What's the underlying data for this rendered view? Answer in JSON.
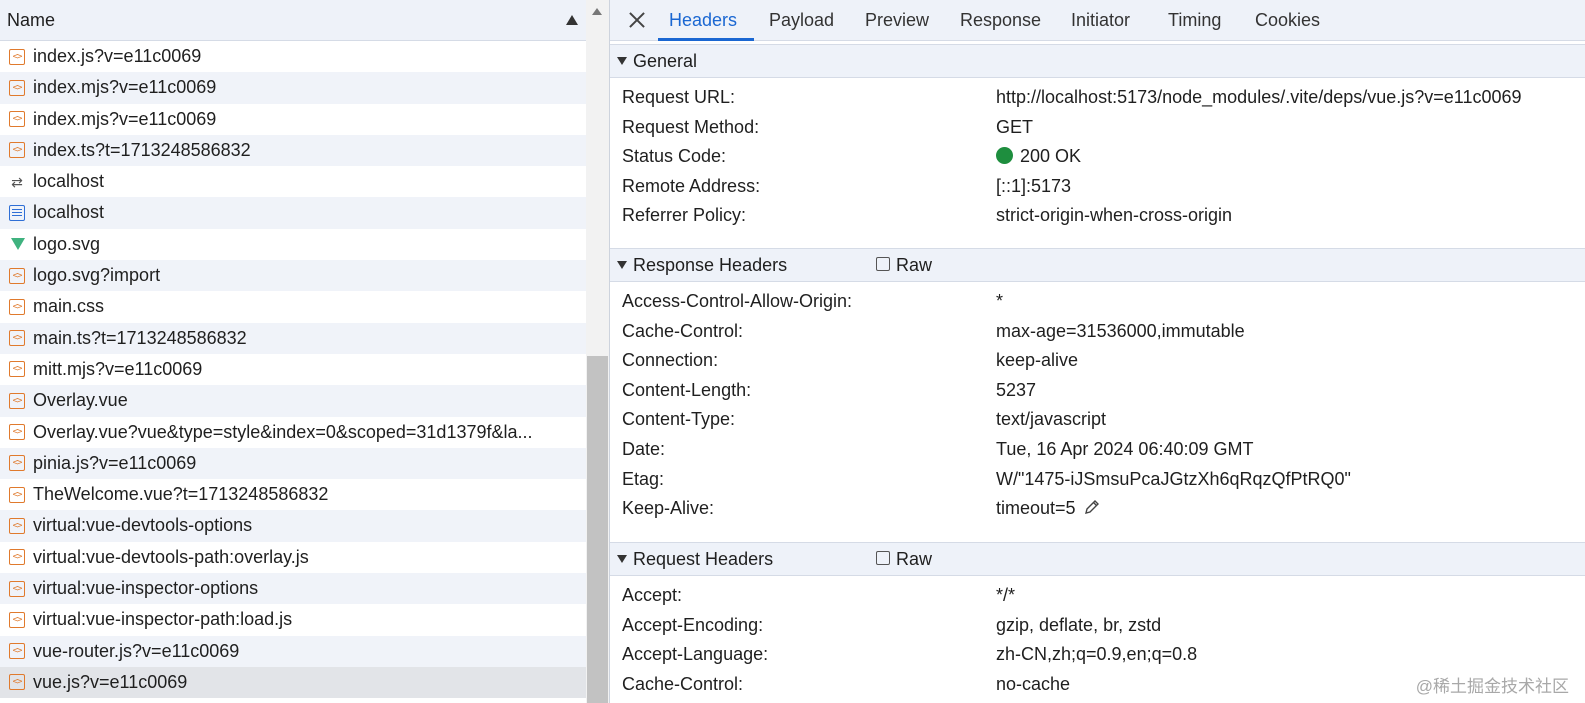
{
  "list": {
    "header": "Name",
    "rows": [
      {
        "name": "index.js?v=e11c0069",
        "icon": "script-icon"
      },
      {
        "name": "index.mjs?v=e11c0069",
        "icon": "script-icon"
      },
      {
        "name": "index.mjs?v=e11c0069",
        "icon": "script-icon"
      },
      {
        "name": "index.ts?t=1713248586832",
        "icon": "script-icon"
      },
      {
        "name": "localhost",
        "icon": "redirect-icon"
      },
      {
        "name": "localhost",
        "icon": "document-icon"
      },
      {
        "name": "logo.svg",
        "icon": "vue-logo-icon"
      },
      {
        "name": "logo.svg?import",
        "icon": "script-icon"
      },
      {
        "name": "main.css",
        "icon": "script-icon"
      },
      {
        "name": "main.ts?t=1713248586832",
        "icon": "script-icon"
      },
      {
        "name": "mitt.mjs?v=e11c0069",
        "icon": "script-icon"
      },
      {
        "name": "Overlay.vue",
        "icon": "script-icon"
      },
      {
        "name": "Overlay.vue?vue&type=style&index=0&scoped=31d1379f&la...",
        "icon": "script-icon"
      },
      {
        "name": "pinia.js?v=e11c0069",
        "icon": "script-icon"
      },
      {
        "name": "TheWelcome.vue?t=1713248586832",
        "icon": "script-icon"
      },
      {
        "name": "virtual:vue-devtools-options",
        "icon": "script-icon"
      },
      {
        "name": "virtual:vue-devtools-path:overlay.js",
        "icon": "script-icon"
      },
      {
        "name": "virtual:vue-inspector-options",
        "icon": "script-icon"
      },
      {
        "name": "virtual:vue-inspector-path:load.js",
        "icon": "script-icon"
      },
      {
        "name": "vue-router.js?v=e11c0069",
        "icon": "script-icon"
      },
      {
        "name": "vue.js?v=e11c0069",
        "icon": "script-icon",
        "selected": true
      },
      {
        "name": "",
        "icon": ""
      }
    ]
  },
  "tabs": [
    "Headers",
    "Payload",
    "Preview",
    "Response",
    "Initiator",
    "Timing",
    "Cookies"
  ],
  "general": {
    "title": "General",
    "items": [
      {
        "k": "Request URL:",
        "v": "http://localhost:5173/node_modules/.vite/deps/vue.js?v=e11c0069"
      },
      {
        "k": "Request Method:",
        "v": "GET"
      },
      {
        "k": "Status Code:",
        "v": "200 OK"
      },
      {
        "k": "Remote Address:",
        "v": "[::1]:5173"
      },
      {
        "k": "Referrer Policy:",
        "v": "strict-origin-when-cross-origin"
      }
    ]
  },
  "response_headers": {
    "title": "Response Headers",
    "raw_label": "Raw",
    "items": [
      {
        "k": "Access-Control-Allow-Origin:",
        "v": "*"
      },
      {
        "k": "Cache-Control:",
        "v": "max-age=31536000,immutable"
      },
      {
        "k": "Connection:",
        "v": "keep-alive"
      },
      {
        "k": "Content-Length:",
        "v": "5237"
      },
      {
        "k": "Content-Type:",
        "v": "text/javascript"
      },
      {
        "k": "Date:",
        "v": "Tue, 16 Apr 2024 06:40:09 GMT"
      },
      {
        "k": "Etag:",
        "v": "W/\"1475-iJSmsuPcaJGtzXh6qRqzQfPtRQ0\""
      },
      {
        "k": "Keep-Alive:",
        "v": "timeout=5"
      }
    ]
  },
  "request_headers": {
    "title": "Request Headers",
    "raw_label": "Raw",
    "items": [
      {
        "k": "Accept:",
        "v": "*/*"
      },
      {
        "k": "Accept-Encoding:",
        "v": "gzip, deflate, br, zstd"
      },
      {
        "k": "Accept-Language:",
        "v": "zh-CN,zh;q=0.9,en;q=0.8"
      },
      {
        "k": "Cache-Control:",
        "v": "no-cache"
      }
    ]
  },
  "watermark": "@稀土掘金技术社区",
  "colors": {
    "accent": "#1a67d2",
    "status_ok": "#1e8e3e",
    "script_icon": "#e07a2d",
    "doc_icon": "#2f6fd6",
    "vue_icon": "#3fb27f"
  }
}
